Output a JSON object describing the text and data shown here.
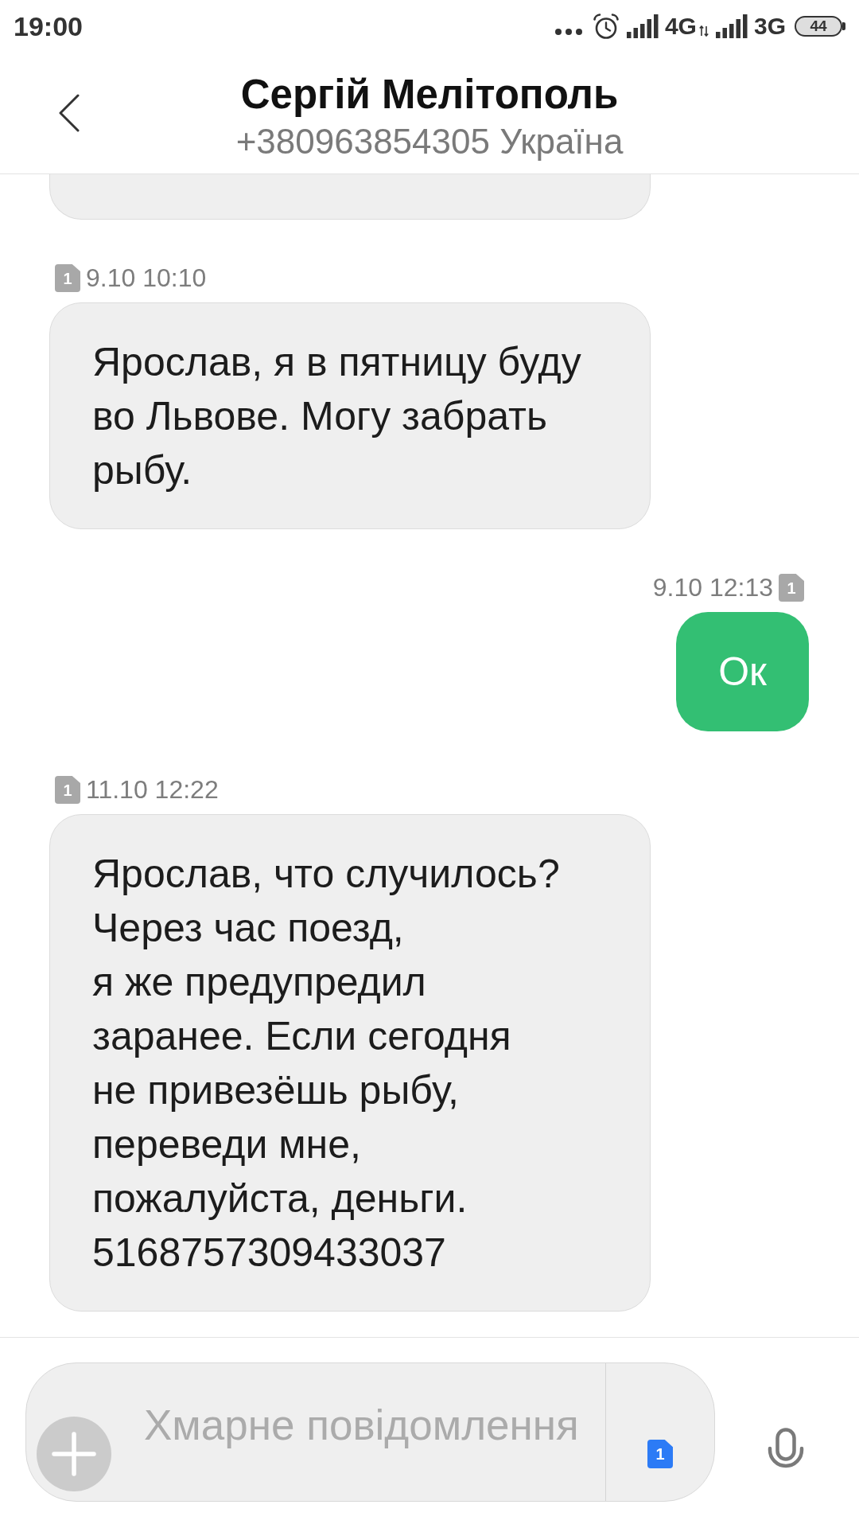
{
  "status_bar": {
    "time": "19:00",
    "networks": [
      {
        "type": "4G",
        "activity": true
      },
      {
        "type": "3G",
        "activity": false
      }
    ],
    "battery": "44"
  },
  "header": {
    "title": "Сергій Мелітополь",
    "subtitle": "+380963854305 Україна"
  },
  "messages": [
    {
      "kind": "incoming",
      "clipped": true
    },
    {
      "kind": "incoming",
      "clipped": false,
      "time": "9.10 10:10",
      "sim": "1",
      "text": "Ярослав, я в пятницу буду во Львове. Могу забрать рыбу."
    },
    {
      "kind": "outgoing",
      "clipped": false,
      "time": "9.10 12:13",
      "sim": "1",
      "text": "Ок"
    },
    {
      "kind": "incoming",
      "clipped": false,
      "time": "11.10 12:22",
      "sim": "1",
      "text": "Ярослав, что случилось?\nЧерез час поезд,\nя же предупредил\nзаранее. Если сегодня\nне привезёшь рыбу,\nпереведи мне,\nпожалуйста, деньги.\n5168757309433037"
    }
  ],
  "composer": {
    "placeholder": "Хмарне повідомлення",
    "sim": "1"
  }
}
